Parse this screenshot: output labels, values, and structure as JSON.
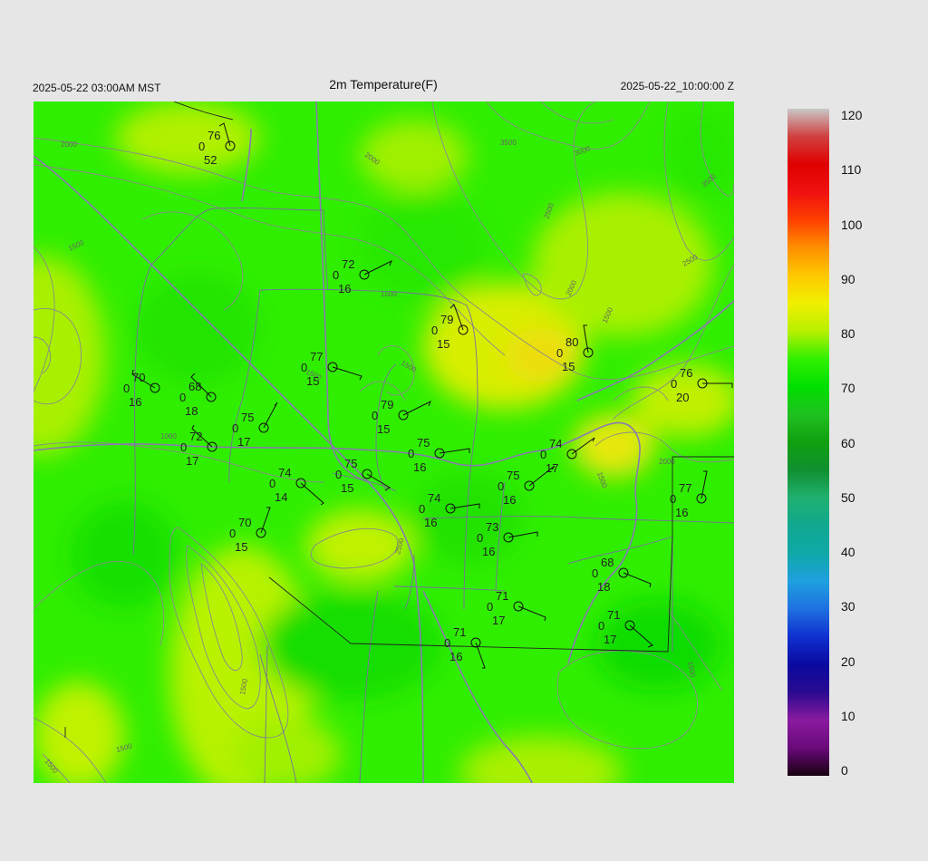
{
  "header": {
    "title": "2m Temperature(F)",
    "valid_local": "2025-05-22 03:00AM MST",
    "valid_utc": "2025-05-22_10:00:00 Z"
  },
  "colorbar": {
    "labels": [
      "120",
      "110",
      "100",
      "90",
      "80",
      "70",
      "60",
      "50",
      "40",
      "30",
      "20",
      "10",
      "0"
    ],
    "stops": [
      [
        "0",
        "#180010"
      ],
      [
        "5",
        "#6a0a7a"
      ],
      [
        "10",
        "#8a1aa0"
      ],
      [
        "15",
        "#2a0a90"
      ],
      [
        "20",
        "#0a0aa0"
      ],
      [
        "25",
        "#1030d0"
      ],
      [
        "30",
        "#1e70e0"
      ],
      [
        "35",
        "#1ea0e0"
      ],
      [
        "40",
        "#10a8a8"
      ],
      [
        "45",
        "#10a890"
      ],
      [
        "50",
        "#20b070"
      ],
      [
        "55",
        "#109030"
      ],
      [
        "60",
        "#10a010"
      ],
      [
        "65",
        "#20c020"
      ],
      [
        "70",
        "#00e000"
      ],
      [
        "75",
        "#30f000"
      ],
      [
        "80",
        "#b8f000"
      ],
      [
        "85",
        "#f0f000"
      ],
      [
        "90",
        "#ffc800"
      ],
      [
        "95",
        "#ff9000"
      ],
      [
        "100",
        "#ff4000"
      ],
      [
        "105",
        "#f01010"
      ],
      [
        "110",
        "#e00000"
      ],
      [
        "115",
        "#d04040"
      ],
      [
        "120",
        "#c8c8c8"
      ]
    ]
  },
  "contour_labels": [
    "2000",
    "2000",
    "1500",
    "1500",
    "1500",
    "1000",
    "2500",
    "3000",
    "3500",
    "2500",
    "2000",
    "1500",
    "3500",
    "2500",
    "1500",
    "1500",
    "2000",
    "1500",
    "1500",
    "1500",
    "1500"
  ],
  "stations": [
    {
      "t": "76",
      "d": "52",
      "w": "0"
    },
    {
      "t": "72",
      "d": "16",
      "w": "0"
    },
    {
      "t": "79",
      "d": "15",
      "w": "0"
    },
    {
      "t": "80",
      "d": "15",
      "w": "0"
    },
    {
      "t": "77",
      "d": "15",
      "w": "0"
    },
    {
      "t": "70",
      "d": "16",
      "w": "0"
    },
    {
      "t": "68",
      "d": "18",
      "w": "0"
    },
    {
      "t": "76",
      "d": "20",
      "w": "0"
    },
    {
      "t": "79",
      "d": "15",
      "w": "0"
    },
    {
      "t": "75",
      "d": "17",
      "w": "0"
    },
    {
      "t": "72",
      "d": "17",
      "w": "0"
    },
    {
      "t": "75",
      "d": "16",
      "w": "0"
    },
    {
      "t": "74",
      "d": "17",
      "w": "0"
    },
    {
      "t": "75",
      "d": "15",
      "w": "0"
    },
    {
      "t": "74",
      "d": "14",
      "w": "0"
    },
    {
      "t": "75",
      "d": "16",
      "w": "0"
    },
    {
      "t": "77",
      "d": "16",
      "w": "0"
    },
    {
      "t": "74",
      "d": "16",
      "w": "0"
    },
    {
      "t": "70",
      "d": "15",
      "w": "0"
    },
    {
      "t": "73",
      "d": "16",
      "w": "0"
    },
    {
      "t": "68",
      "d": "18",
      "w": "0"
    },
    {
      "t": "71",
      "d": "17",
      "w": "0"
    },
    {
      "t": "71",
      "d": "17",
      "w": "0"
    },
    {
      "t": "71",
      "d": "16",
      "w": "0"
    }
  ]
}
